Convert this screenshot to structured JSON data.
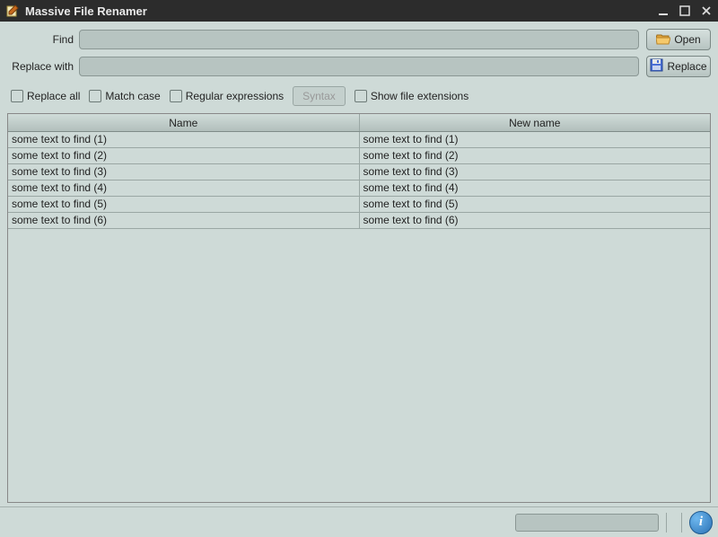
{
  "window": {
    "title": "Massive File Renamer"
  },
  "form": {
    "find_label": "Find",
    "find_value": "",
    "replace_label": "Replace with",
    "replace_value": ""
  },
  "buttons": {
    "open": "Open",
    "replace": "Replace",
    "syntax": "Syntax"
  },
  "options": {
    "replace_all": "Replace all",
    "match_case": "Match case",
    "regex": "Regular expressions",
    "show_ext": "Show file extensions"
  },
  "table": {
    "headers": {
      "name": "Name",
      "new_name": "New name"
    },
    "rows": [
      {
        "name": "some text to find (1)",
        "new_name": "some text to find (1)"
      },
      {
        "name": "some text to find (2)",
        "new_name": "some text to find (2)"
      },
      {
        "name": "some text to find (3)",
        "new_name": "some text to find (3)"
      },
      {
        "name": "some text to find (4)",
        "new_name": "some text to find (4)"
      },
      {
        "name": "some text to find (5)",
        "new_name": "some text to find (5)"
      },
      {
        "name": "some text to find (6)",
        "new_name": "some text to find (6)"
      }
    ]
  },
  "status": {
    "language": "en-GB"
  }
}
